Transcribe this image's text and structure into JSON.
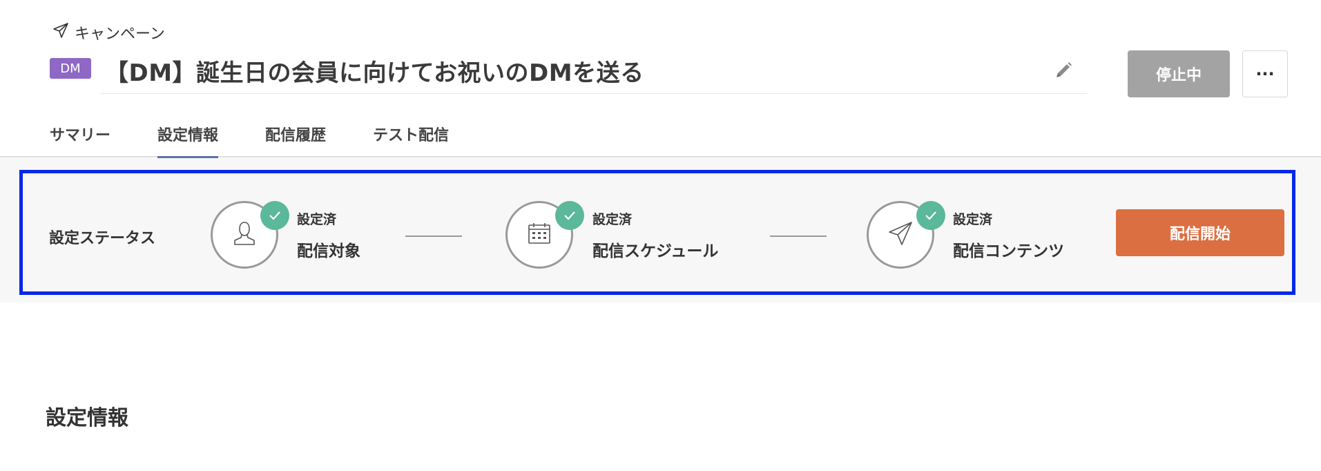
{
  "breadcrumb": {
    "label": "キャンペーン",
    "icon": "paper-plane-icon"
  },
  "campaign": {
    "badge": "DM",
    "title": "【DM】誕生日の会員に向けてお祝いのDMを送る",
    "status_button": "停止中",
    "more_button": "···"
  },
  "tabs": [
    {
      "label": "サマリー",
      "active": false
    },
    {
      "label": "設定情報",
      "active": true
    },
    {
      "label": "配信履歴",
      "active": false
    },
    {
      "label": "テスト配信",
      "active": false
    }
  ],
  "status_panel": {
    "label": "設定ステータス",
    "steps": [
      {
        "status": "設定済",
        "label": "配信対象",
        "icon": "person-icon"
      },
      {
        "status": "設定済",
        "label": "配信スケジュール",
        "icon": "calendar-icon"
      },
      {
        "status": "設定済",
        "label": "配信コンテンツ",
        "icon": "paper-plane-icon"
      }
    ],
    "start_button": "配信開始"
  },
  "section": {
    "title": "設定情報"
  },
  "colors": {
    "badge": "#8e68c4",
    "status_button": "#a3a3a3",
    "start_button": "#db6f42",
    "check": "#5bb89a",
    "panel_border": "#0028ea",
    "tab_active": "#5a74a8"
  }
}
